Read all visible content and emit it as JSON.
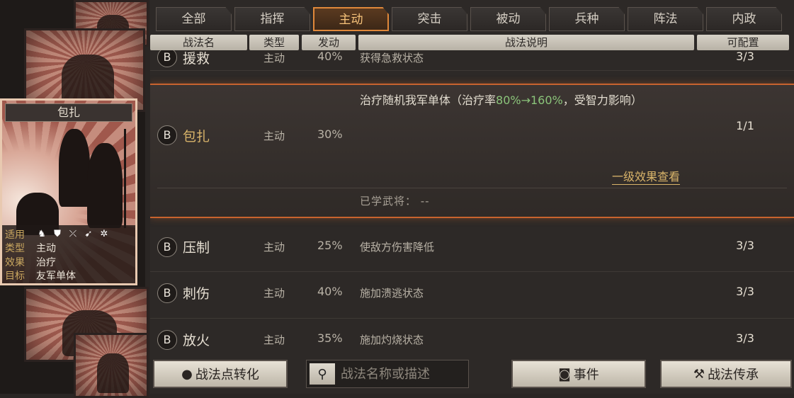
{
  "tabs": [
    "全部",
    "指挥",
    "主动",
    "突击",
    "被动",
    "兵种",
    "阵法",
    "内政"
  ],
  "active_tab": "主动",
  "columns": {
    "name": "战法名",
    "type": "类型",
    "rate": "发动",
    "desc": "战法说明",
    "slots": "可配置"
  },
  "card": {
    "title": "包扎",
    "suits_label": "适用",
    "type_label": "类型",
    "type_value": "主动",
    "effect_label": "效果",
    "effect_value": "治疗",
    "target_label": "目标",
    "target_value": "友军单体",
    "unit_icons": [
      "cavalry-icon",
      "shield-icon",
      "bow-icon",
      "spear-icon",
      "wheel-icon"
    ]
  },
  "rows": [
    {
      "grade": "B",
      "name": "援救",
      "type": "主动",
      "rate": "40%",
      "desc": "获得急救状态",
      "slots": "3/3"
    },
    {
      "grade": "B",
      "name": "包扎",
      "type": "主动",
      "rate": "30%",
      "desc_prefix": "治疗随机我军单体（治疗率",
      "desc_highlight": "80%→160%",
      "desc_suffix": "，受智力影响）",
      "slots": "1/1",
      "view_link": "一级效果查看",
      "learned": "已学武将： --"
    },
    {
      "grade": "B",
      "name": "压制",
      "type": "主动",
      "rate": "25%",
      "desc": "使敌方伤害降低",
      "slots": "3/3"
    },
    {
      "grade": "B",
      "name": "刺伤",
      "type": "主动",
      "rate": "40%",
      "desc": "施加溃逃状态",
      "slots": "3/3"
    },
    {
      "grade": "B",
      "name": "放火",
      "type": "主动",
      "rate": "35%",
      "desc": "施加灼烧状态",
      "slots": "3/3"
    }
  ],
  "bottom": {
    "convert_label": "战法点转化",
    "search_placeholder": "战法名称或描述",
    "event_label": "事件",
    "inherit_label": "战法传承"
  },
  "colors": {
    "accent": "#e0883a",
    "highlight": "#8bc47a",
    "gold": "#d9b46a"
  }
}
